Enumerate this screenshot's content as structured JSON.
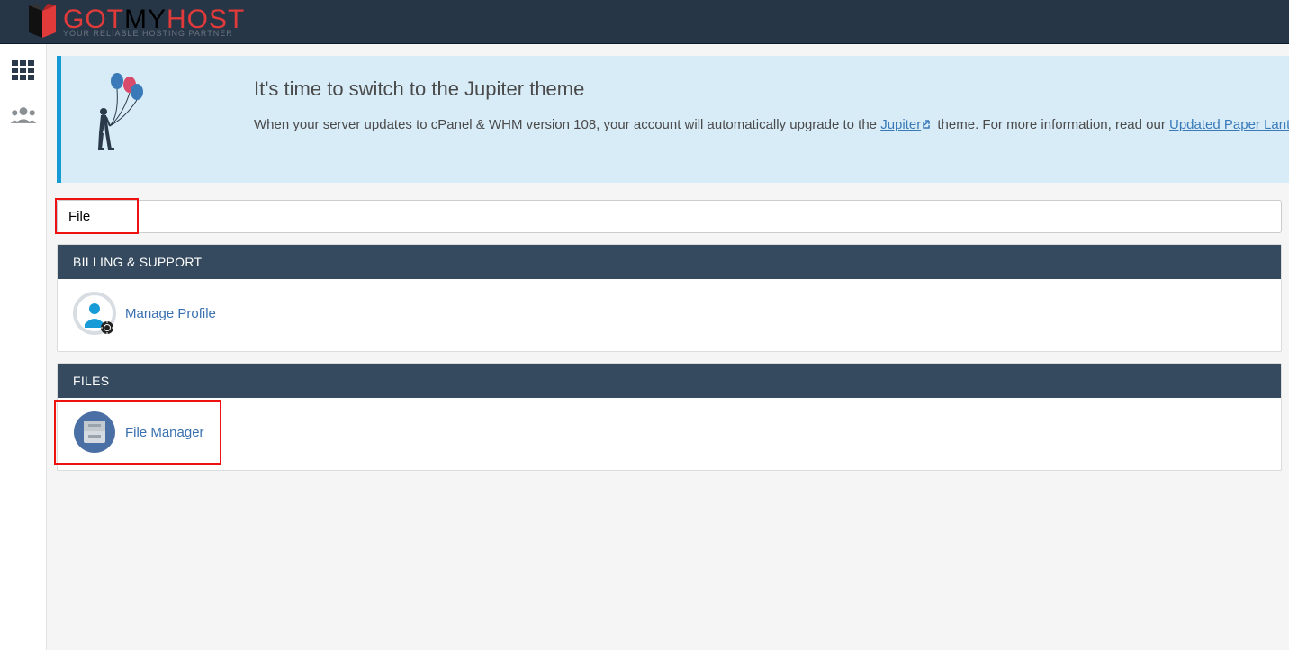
{
  "brand": {
    "got": "GOT",
    "my": "MY",
    "host": "HOST",
    "tagline": "YOUR RELIABLE HOSTING PARTNER"
  },
  "notice": {
    "title": "It's time to switch to the Jupiter theme",
    "body_pre": "When your server updates to cPanel & WHM version 108, your account will automatically upgrade to the ",
    "link1": "Jupiter",
    "body_mid": " theme. For more information, read our ",
    "link2": "Updated Paper Lantern R"
  },
  "search": {
    "value": "File"
  },
  "panels": {
    "billing": {
      "header": "BILLING & SUPPORT",
      "item": "Manage Profile"
    },
    "files": {
      "header": "FILES",
      "item": "File Manager"
    }
  }
}
